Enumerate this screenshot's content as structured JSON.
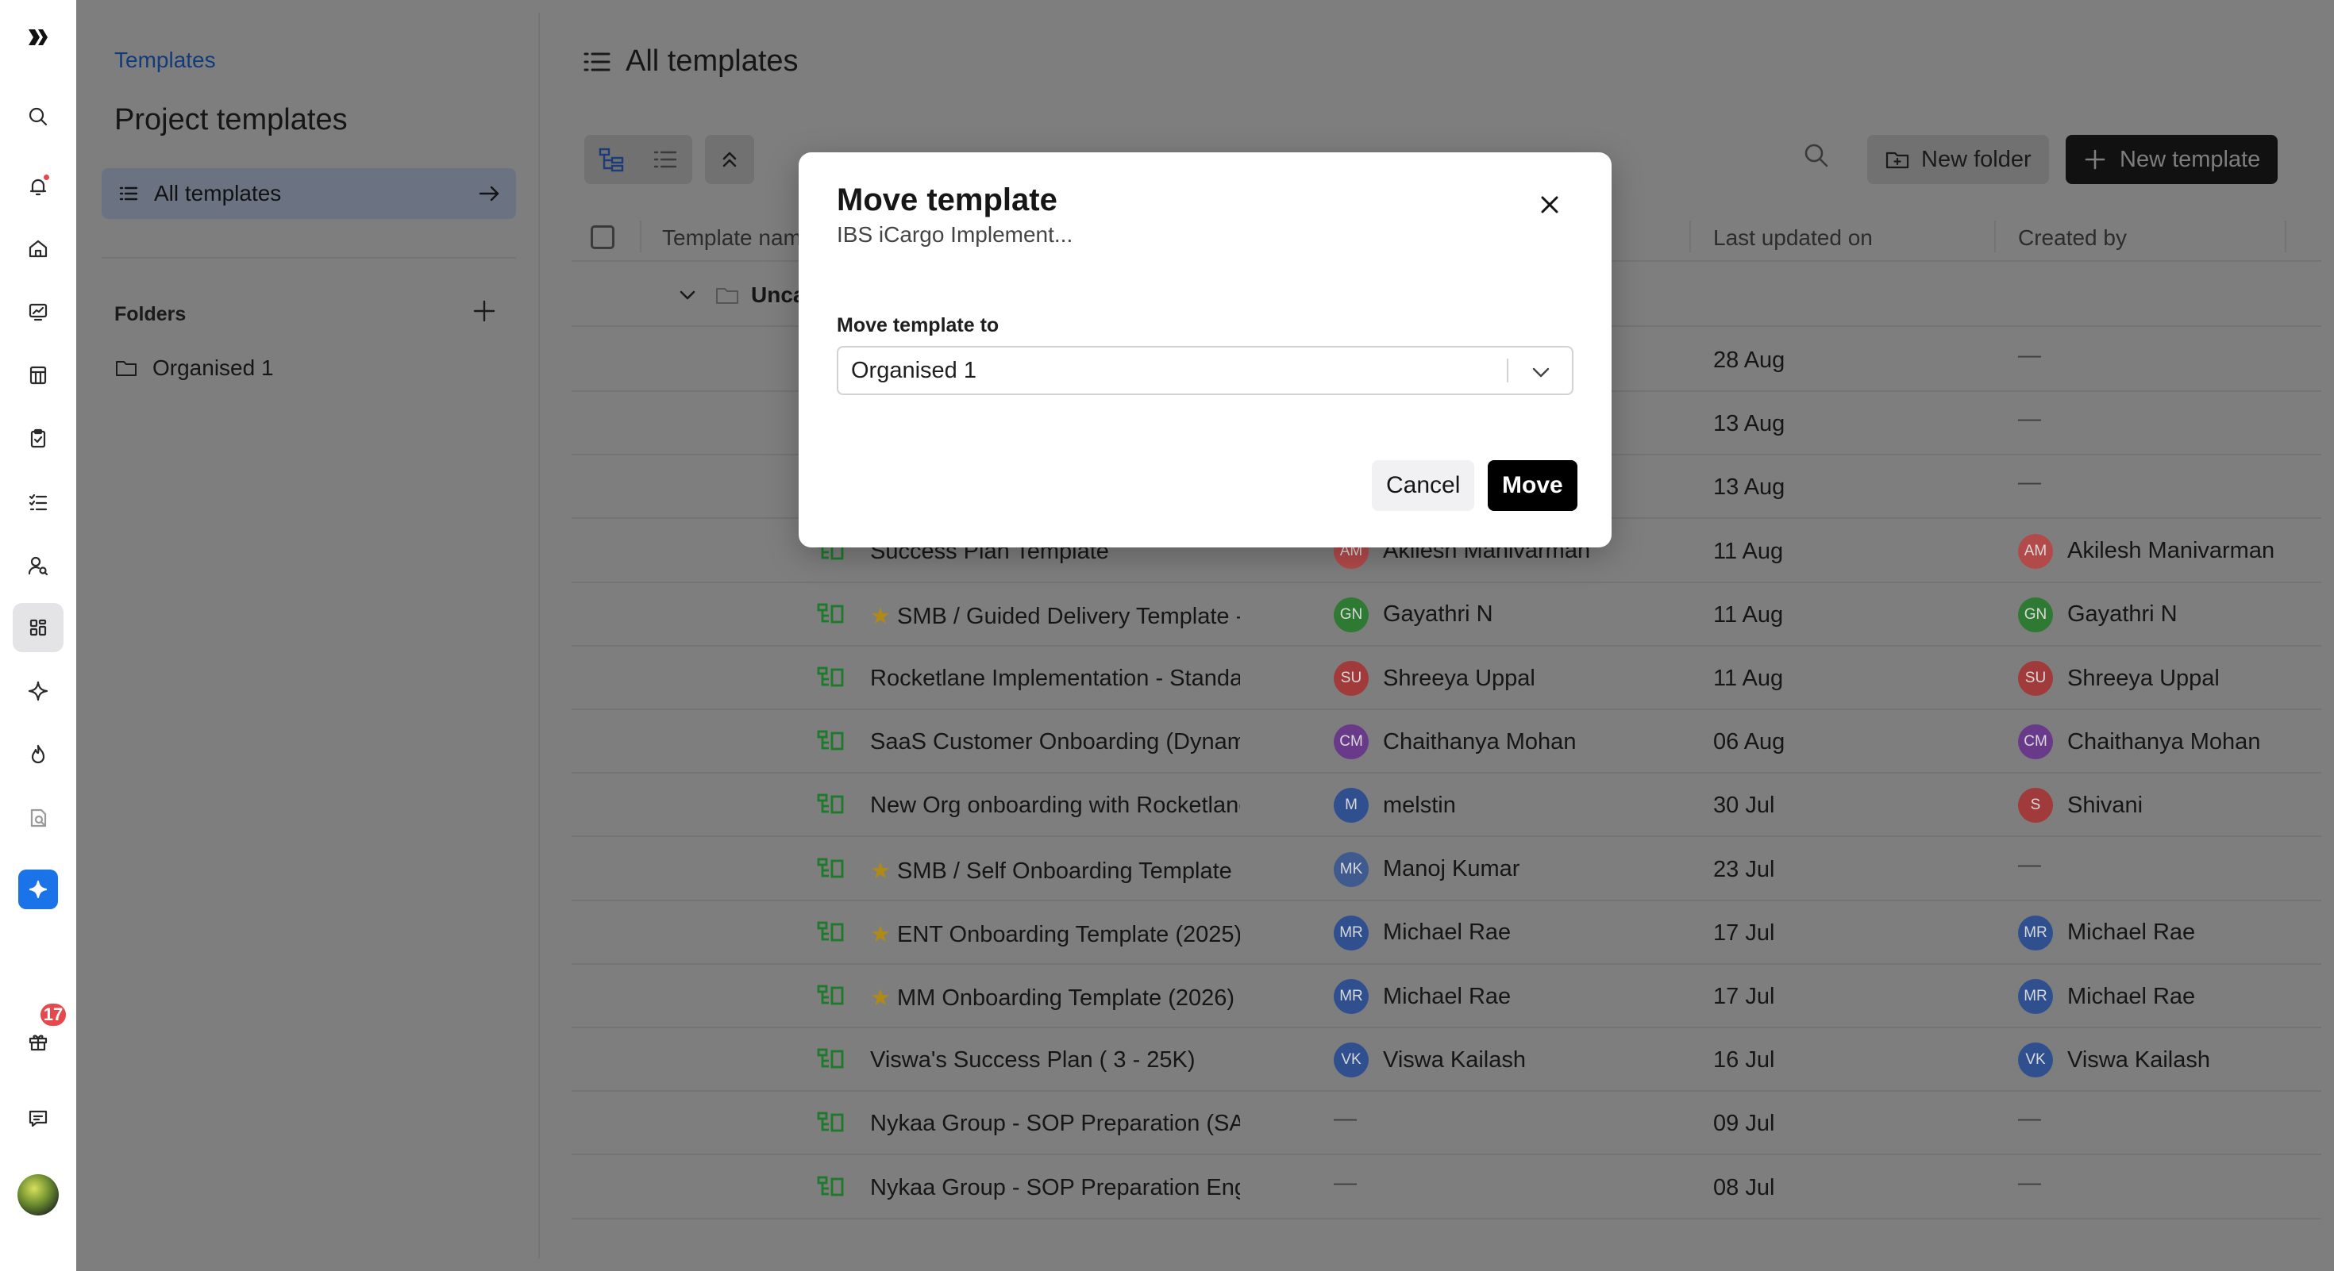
{
  "rail": {
    "items": [
      {
        "name": "logo-icon"
      },
      {
        "name": "search-icon"
      },
      {
        "name": "notifications-icon"
      },
      {
        "name": "home-icon"
      },
      {
        "name": "dashboard-icon"
      },
      {
        "name": "projects-icon"
      },
      {
        "name": "tasks-icon"
      },
      {
        "name": "checklist-icon"
      },
      {
        "name": "people-icon"
      },
      {
        "name": "templates-icon"
      },
      {
        "name": "sparkle-icon"
      },
      {
        "name": "fire-icon"
      },
      {
        "name": "reports-icon"
      },
      {
        "name": "ai-assistant-icon"
      },
      {
        "name": "gift-icon"
      },
      {
        "name": "chat-icon"
      }
    ],
    "gift_badge": "17"
  },
  "sidebar": {
    "breadcrumb": "Templates",
    "title": "Project templates",
    "all_templates": "All templates",
    "folders_label": "Folders",
    "folders": [
      "Organised 1"
    ]
  },
  "main": {
    "title": "All templates",
    "new_folder": "New folder",
    "new_template": "New template",
    "columns": {
      "name": "Template name",
      "updated": "Last updated on",
      "created": "Created by"
    },
    "group_name": "Uncategorised",
    "rows": [
      {
        "name": "",
        "star": false,
        "owner": "",
        "owner_initials": "",
        "owner_color": "",
        "date": "28 Aug",
        "creator": "—",
        "creator_initials": "",
        "creator_color": ""
      },
      {
        "name": "",
        "star": false,
        "owner": "",
        "owner_initials": "",
        "owner_color": "",
        "date": "13 Aug",
        "creator": "—",
        "creator_initials": "",
        "creator_color": ""
      },
      {
        "name": "",
        "star": false,
        "owner": "",
        "owner_initials": "",
        "owner_color": "",
        "date": "13 Aug",
        "creator": "—",
        "creator_initials": "",
        "creator_color": ""
      },
      {
        "name": "Success Plan Template",
        "star": false,
        "owner": "Akilesh Manivarman",
        "owner_initials": "AM",
        "owner_color": "#b34a4a",
        "date": "11 Aug",
        "creator": "Akilesh Manivarman",
        "creator_initials": "AM",
        "creator_color": "#b34a4a"
      },
      {
        "name": "SMB / Guided Delivery Template -",
        "star": true,
        "owner": "Gayathri N",
        "owner_initials": "GN",
        "owner_color": "#2f7a32",
        "date": "11 Aug",
        "creator": "Gayathri N",
        "creator_initials": "GN",
        "creator_color": "#2f7a32"
      },
      {
        "name": "Rocketlane Implementation - Standard",
        "star": false,
        "owner": "Shreeya Uppal",
        "owner_initials": "SU",
        "owner_color": "#a13a3a",
        "date": "11 Aug",
        "creator": "Shreeya Uppal",
        "creator_initials": "SU",
        "creator_color": "#a13a3a"
      },
      {
        "name": "SaaS Customer Onboarding (Dynamic)",
        "star": false,
        "owner": "Chaithanya Mohan",
        "owner_initials": "CM",
        "owner_color": "#6a3a8a",
        "date": "06 Aug",
        "creator": "Chaithanya Mohan",
        "creator_initials": "CM",
        "creator_color": "#6a3a8a"
      },
      {
        "name": "New Org onboarding with Rocketlane",
        "star": false,
        "owner": "melstin",
        "owner_initials": "M",
        "owner_color": "#2f4f8f",
        "date": "30 Jul",
        "creator": "Shivani",
        "creator_initials": "S",
        "creator_color": "#a13a3a"
      },
      {
        "name": "SMB / Self Onboarding Template",
        "star": true,
        "owner": "Manoj Kumar",
        "owner_initials": "MK",
        "owner_color": "#3f5a8f",
        "date": "23 Jul",
        "creator": "—",
        "creator_initials": "",
        "creator_color": ""
      },
      {
        "name": "ENT Onboarding Template (2025)",
        "star": true,
        "owner": "Michael Rae",
        "owner_initials": "MR",
        "owner_color": "#2f4f8f",
        "date": "17 Jul",
        "creator": "Michael Rae",
        "creator_initials": "MR",
        "creator_color": "#2f4f8f"
      },
      {
        "name": "MM Onboarding Template (2026)",
        "star": true,
        "owner": "Michael Rae",
        "owner_initials": "MR",
        "owner_color": "#2f4f8f",
        "date": "17 Jul",
        "creator": "Michael Rae",
        "creator_initials": "MR",
        "creator_color": "#2f4f8f"
      },
      {
        "name": "Viswa's Success Plan ( 3 - 25K)",
        "star": false,
        "owner": "Viswa Kailash",
        "owner_initials": "VK",
        "owner_color": "#2f4f8f",
        "date": "16 Jul",
        "creator": "Viswa Kailash",
        "creator_initials": "VK",
        "creator_color": "#2f4f8f"
      },
      {
        "name": "Nykaa Group - SOP Preparation (SAP)",
        "star": false,
        "owner": "—",
        "owner_initials": "",
        "owner_color": "",
        "date": "09 Jul",
        "creator": "—",
        "creator_initials": "",
        "creator_color": ""
      },
      {
        "name": "Nykaa Group - SOP Preparation Eng",
        "star": false,
        "owner": "—",
        "owner_initials": "",
        "owner_color": "",
        "date": "08 Jul",
        "creator": "—",
        "creator_initials": "",
        "creator_color": ""
      }
    ]
  },
  "modal": {
    "title": "Move template",
    "subtitle": "IBS iCargo Implement...",
    "field_label": "Move template to",
    "selected": "Organised 1",
    "cancel": "Cancel",
    "move": "Move"
  },
  "colors": {
    "accent": "#1a73e8",
    "primary_button": "#000000",
    "badge": "#e5484d",
    "template_icon": "#1c7a2a"
  }
}
